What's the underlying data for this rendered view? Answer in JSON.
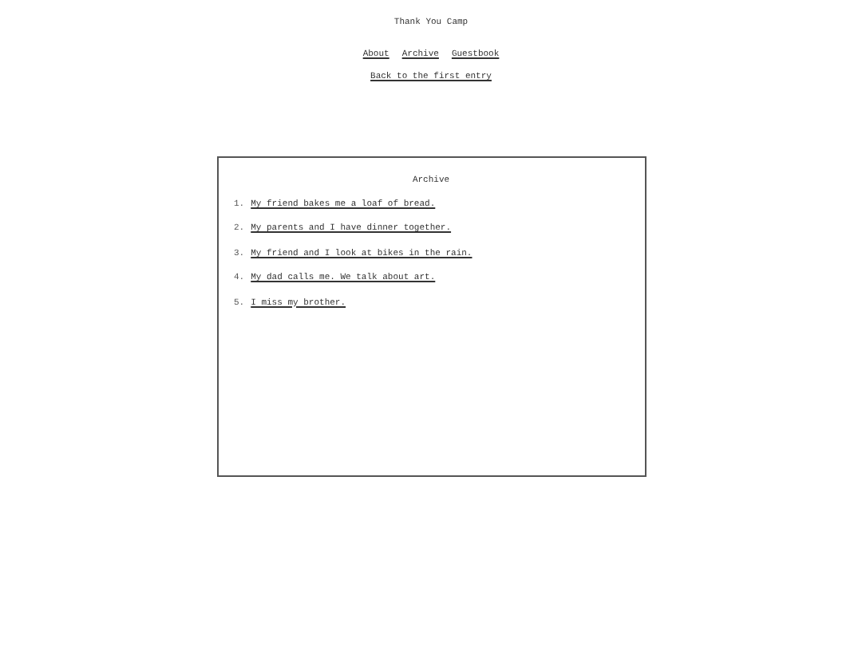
{
  "site_title": "Thank You Camp",
  "nav": [
    {
      "label": "About"
    },
    {
      "label": "Archive"
    },
    {
      "label": "Guestbook"
    }
  ],
  "back_link": "Back to the first entry",
  "archive": {
    "title": "Archive",
    "entries": [
      {
        "number": "1.",
        "title": "My friend bakes me a loaf of bread."
      },
      {
        "number": "2.",
        "title": "My parents and I have dinner together."
      },
      {
        "number": "3.",
        "title": "My friend and I look at bikes in the rain."
      },
      {
        "number": "4.",
        "title": "My dad calls me. We talk about art."
      },
      {
        "number": "5.",
        "title": "I miss my brother."
      }
    ]
  }
}
